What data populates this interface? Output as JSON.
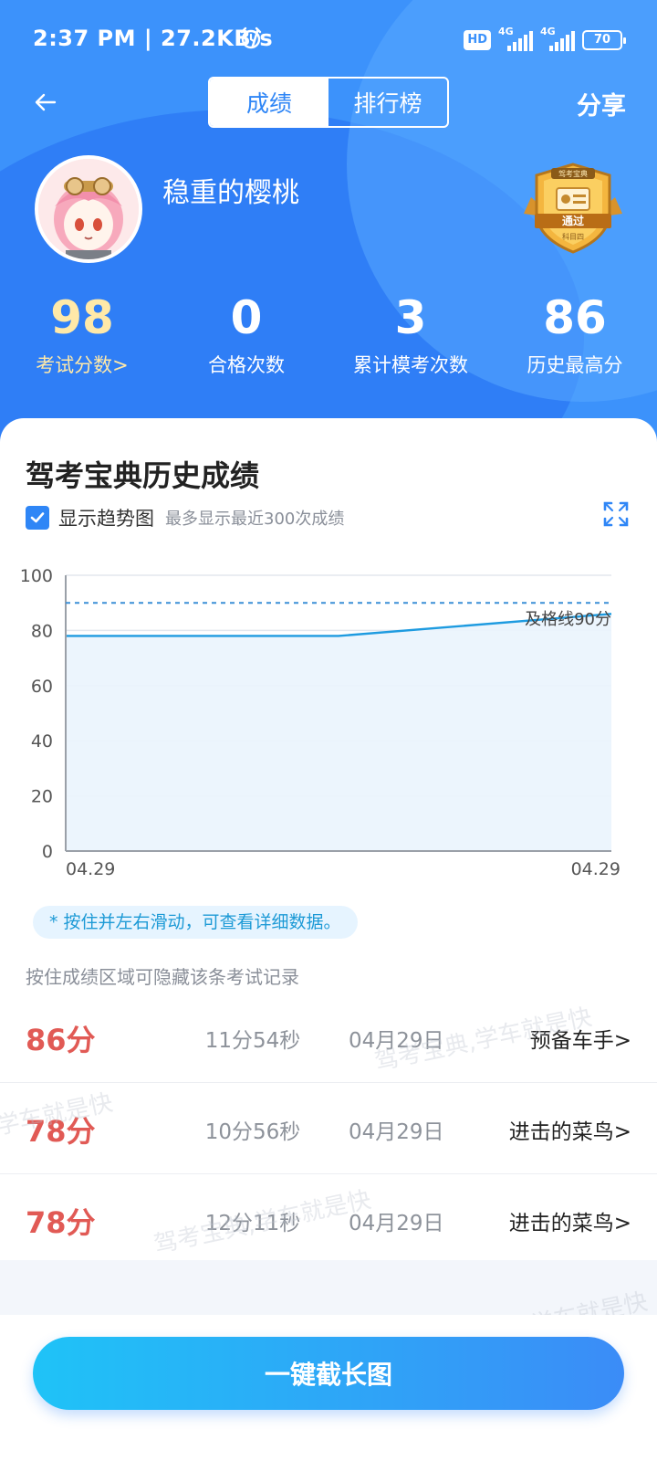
{
  "status_bar": {
    "time": "2:37 PM | 27.2KB/s",
    "hd": "HD",
    "net1": "4G",
    "net2": "4G",
    "battery": "70"
  },
  "nav": {
    "tab_scores": "成绩",
    "tab_ranking": "排行榜",
    "share": "分享",
    "active_tab": "成绩"
  },
  "profile": {
    "username": "稳重的樱桃",
    "badge_top": "驾考宝典",
    "badge_main": "通过",
    "badge_bottom": "科目四"
  },
  "stats": [
    {
      "value": "98",
      "label": "考试分数>"
    },
    {
      "value": "0",
      "label": "合格次数"
    },
    {
      "value": "3",
      "label": "累计模考次数"
    },
    {
      "value": "86",
      "label": "历史最高分"
    }
  ],
  "history": {
    "title": "驾考宝典历史成绩",
    "show_trend_label": "显示趋势图",
    "show_trend_checked": true,
    "limit_hint": "最多显示最近300次成绩",
    "tip": "* 按住并左右滑动，可查看详细数据。",
    "hide_hint": "按住成绩区域可隐藏该条考试记录"
  },
  "chart_data": {
    "type": "area",
    "x": [
      "04.29",
      "04.29",
      "04.29"
    ],
    "values": [
      78,
      78,
      86
    ],
    "ylim": [
      0,
      100
    ],
    "yticks": [
      0,
      20,
      40,
      60,
      80,
      100
    ],
    "xtick_labels": [
      "04.29",
      "04.29"
    ],
    "pass_line": {
      "value": 90,
      "label": "及格线90分"
    },
    "grid": true,
    "line_color": "#1e9be0",
    "pass_line_color": "#3b8fd6"
  },
  "records": [
    {
      "score": "86分",
      "duration": "11分54秒",
      "date": "04月29日",
      "level": "预备车手>"
    },
    {
      "score": "78分",
      "duration": "10分56秒",
      "date": "04月29日",
      "level": "进击的菜鸟>"
    },
    {
      "score": "78分",
      "duration": "12分11秒",
      "date": "04月29日",
      "level": "进击的菜鸟>"
    }
  ],
  "watermarks": [
    "驾考宝典,学车就是快",
    "学车就是快",
    "驾考宝典,学车就是快",
    "学车就是快"
  ],
  "bottom": {
    "button_label": "一键截长图"
  },
  "colors": {
    "header_blue": "#3c92fb",
    "score_red": "#e15a55",
    "accent_blue": "#2f86f6",
    "highlight_gold": "#ffe9a8"
  }
}
